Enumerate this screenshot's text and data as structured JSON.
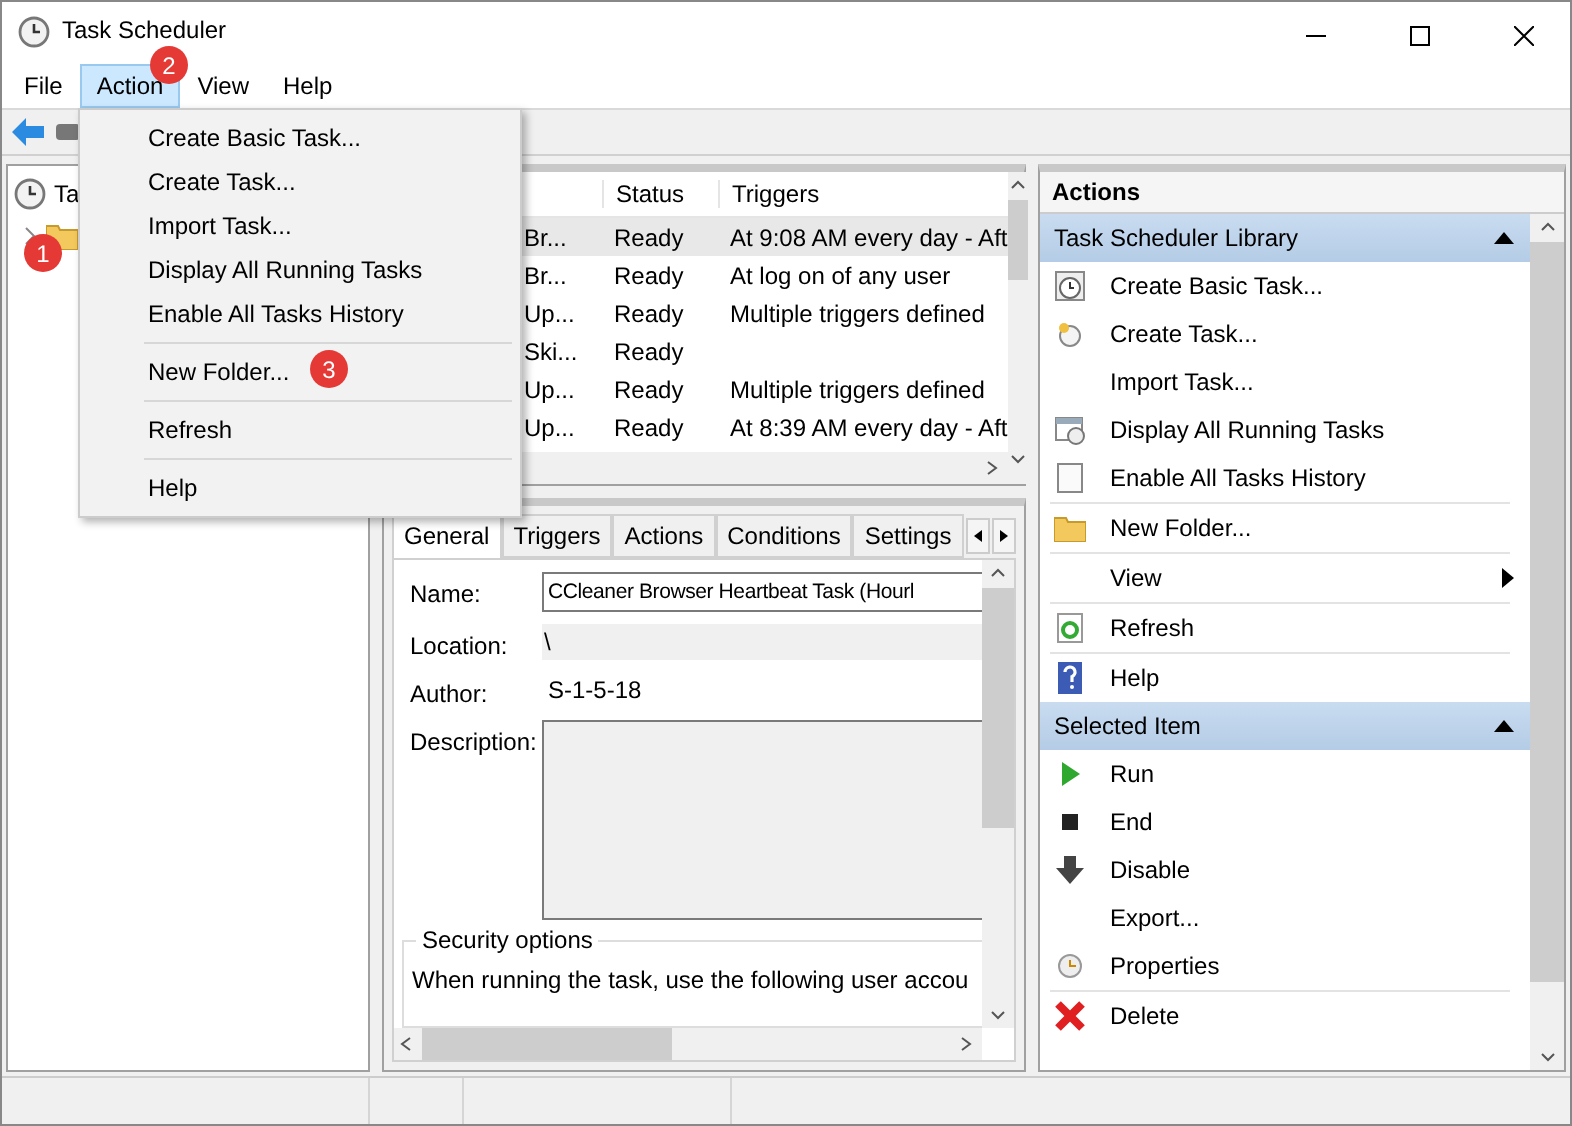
{
  "window": {
    "title": "Task Scheduler"
  },
  "menu_bar": [
    {
      "label": "File",
      "selected": false
    },
    {
      "label": "Action",
      "selected": true
    },
    {
      "label": "View",
      "selected": false
    },
    {
      "label": "Help",
      "selected": false
    }
  ],
  "action_menu": {
    "groups": [
      [
        "Create Basic Task...",
        "Create Task...",
        "Import Task...",
        "Display All Running Tasks",
        "Enable All Tasks History"
      ],
      [
        "New Folder..."
      ],
      [
        "Refresh"
      ],
      [
        "Help"
      ]
    ]
  },
  "markers": [
    {
      "label": "1"
    },
    {
      "label": "2"
    },
    {
      "label": "3"
    }
  ],
  "tree": {
    "label": "Ta",
    "children": [
      {
        "expanded": false
      }
    ]
  },
  "task_list": {
    "columns": [
      "Status",
      "Triggers"
    ],
    "rows": [
      {
        "column_1": "Br...",
        "status": "Ready",
        "triggers": "At 9:08 AM every day - Aft",
        "selected": true
      },
      {
        "column_1": "Br...",
        "status": "Ready",
        "triggers": "At log on of any user",
        "selected": false
      },
      {
        "column_1": "Up...",
        "status": "Ready",
        "triggers": "Multiple triggers defined",
        "selected": false
      },
      {
        "column_1": "Ski...",
        "status": "Ready",
        "triggers": "",
        "selected": false
      },
      {
        "column_1": "Up...",
        "status": "Ready",
        "triggers": "Multiple triggers defined",
        "selected": false
      },
      {
        "column_1": "Up...",
        "status": "Ready",
        "triggers": "At 8:39 AM every day - Aft",
        "selected": false
      }
    ]
  },
  "details": {
    "tabs": [
      {
        "label": "General",
        "selected": true
      },
      {
        "label": "Triggers",
        "selected": false
      },
      {
        "label": "Actions",
        "selected": false
      },
      {
        "label": "Conditions",
        "selected": false
      },
      {
        "label": "Settings",
        "selected": false
      }
    ],
    "name_label": "Name:",
    "name_value": "CCleaner Browser Heartbeat Task (Hourl",
    "location_label": "Location:",
    "location_value": "\\",
    "author_label": "Author:",
    "author_value": "S-1-5-18",
    "description_label": "Description:",
    "security_title": "Security options",
    "security_text": "When running the task, use the following user accou"
  },
  "actions_pane": {
    "title": "Actions",
    "sections": [
      {
        "title": "Task Scheduler Library",
        "expanded": true,
        "groups": [
          [
            {
              "label": "Create Basic Task...",
              "submenu": false
            },
            {
              "label": "Create Task...",
              "submenu": false
            },
            {
              "label": "Import Task...",
              "submenu": false
            },
            {
              "label": "Display All Running Tasks",
              "submenu": false
            },
            {
              "label": "Enable All Tasks History",
              "submenu": false
            }
          ],
          [
            {
              "label": "New Folder...",
              "submenu": false
            }
          ],
          [
            {
              "label": "View",
              "submenu": true
            }
          ],
          [
            {
              "label": "Refresh",
              "submenu": false
            }
          ],
          [
            {
              "label": "Help",
              "submenu": false
            }
          ]
        ]
      },
      {
        "title": "Selected Item",
        "expanded": true,
        "groups": [
          [
            {
              "label": "Run",
              "submenu": false
            },
            {
              "label": "End",
              "submenu": false
            },
            {
              "label": "Disable",
              "submenu": false
            },
            {
              "label": "Export...",
              "submenu": false
            },
            {
              "label": "Properties",
              "submenu": false
            }
          ],
          [
            {
              "label": "Delete",
              "submenu": false
            }
          ]
        ]
      }
    ]
  }
}
